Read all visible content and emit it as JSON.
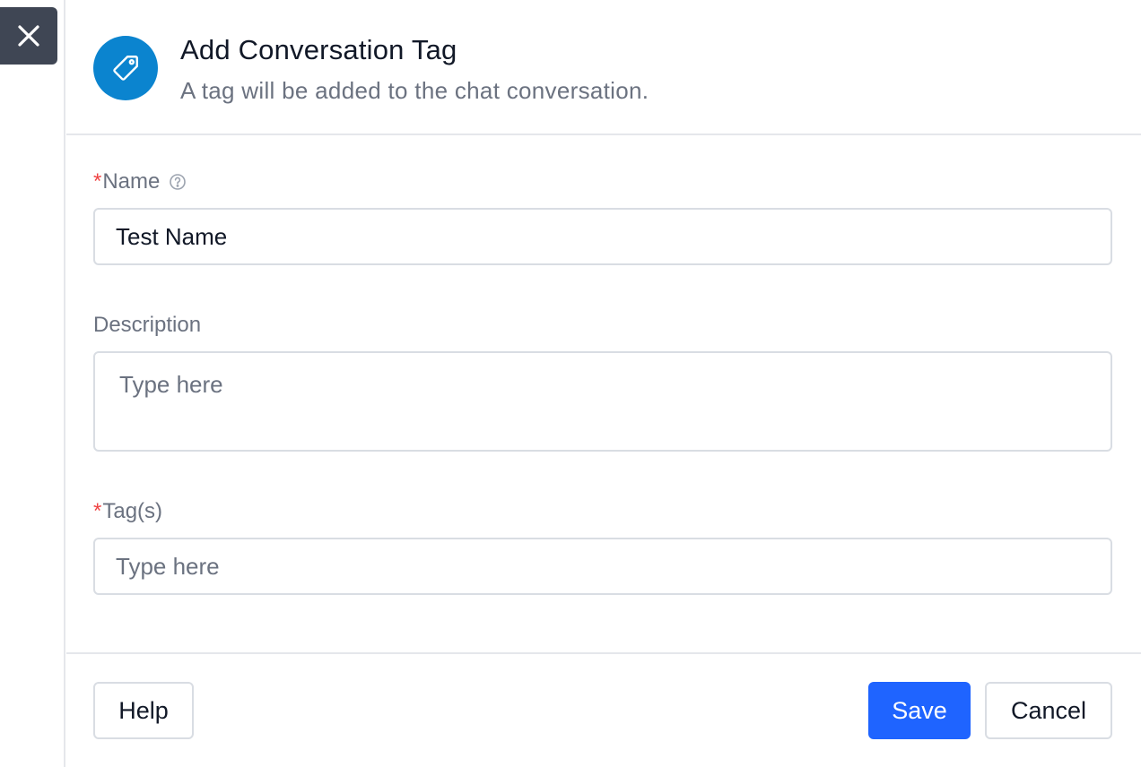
{
  "header": {
    "title": "Add Conversation Tag",
    "subtitle": "A tag will be added to the chat conversation.",
    "icon": "tag-icon",
    "icon_bg": "#0b84cf"
  },
  "close_button": {
    "icon": "close-icon"
  },
  "form": {
    "name": {
      "required_marker": "*",
      "label": "Name",
      "value": "Test Name",
      "help_icon": "help-circle-icon"
    },
    "description": {
      "label": "Description",
      "placeholder": "Type here"
    },
    "tags": {
      "required_marker": "*",
      "label": "Tag(s)",
      "placeholder": "Type here"
    }
  },
  "footer": {
    "help_label": "Help",
    "save_label": "Save",
    "cancel_label": "Cancel",
    "save_color": "#1f64ff"
  }
}
